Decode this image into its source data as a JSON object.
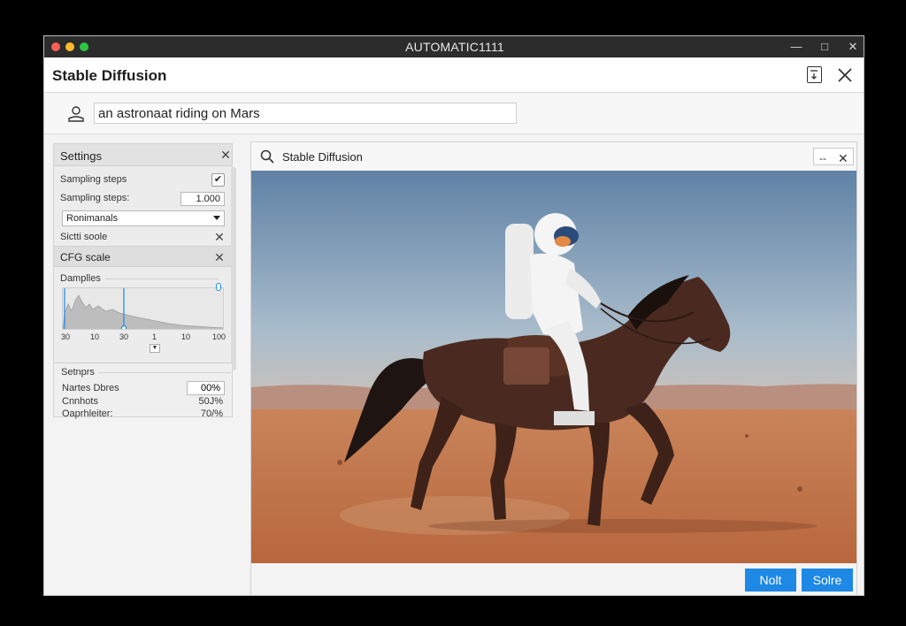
{
  "window": {
    "title": "AUTOMATIC1111"
  },
  "app": {
    "title": "Stable Diffusion"
  },
  "prompt": {
    "value": "an astronaat riding on Mars"
  },
  "settings": {
    "title": "Settings",
    "sampling_steps_label": "Sampling steps",
    "sampling_steps_checked": true,
    "sampling_steps_label_2": "Sampling steps:",
    "sampling_steps_value": "1.000",
    "sampler_selected": "Ronimanals",
    "extra_row_label": "Sictti soole",
    "cfg_scale_label": "CFG scale",
    "samples_label": "Damplles",
    "graph_ticks": [
      "30",
      "10",
      "30",
      "1",
      "10",
      "100"
    ],
    "sub": {
      "title": "Setnprs",
      "rows": [
        {
          "label": "Nartes Dbres",
          "value": "00%"
        },
        {
          "label": "Cnnhots",
          "value": "50J%"
        },
        {
          "label": "Oaprhleiter:",
          "value": "70/%"
        }
      ]
    }
  },
  "viewer": {
    "title": "Stable Diffusion",
    "min_label": "--"
  },
  "footer": {
    "button_1": "Nolt",
    "button_2": "Solre"
  },
  "colors": {
    "accent": "#1e88e5",
    "titlebar": "#2c2c2c",
    "sky": "#6e8fae",
    "sand": "#c27a4c"
  }
}
